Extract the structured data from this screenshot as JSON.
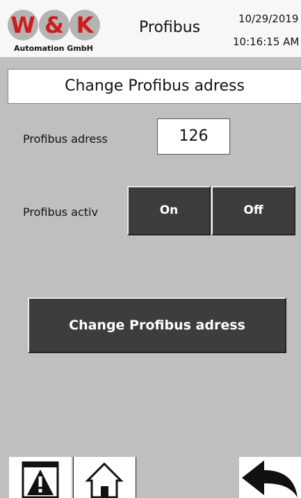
{
  "header": {
    "logo_letters": [
      "W",
      "&",
      "K"
    ],
    "logo_subtitle": "Automation GmbH",
    "title": "Profibus",
    "date": "10/29/2019",
    "time": "10:16:15 AM"
  },
  "banner": {
    "title": "Change Profibus adress"
  },
  "address": {
    "label": "Profibus adress",
    "value": "126"
  },
  "active": {
    "label": "Profibus activ",
    "on_label": "On",
    "off_label": "Off"
  },
  "change_button": {
    "label": "Change Profibus adress"
  },
  "nav": {
    "icons": [
      "warning-icon",
      "home-icon",
      "back-arrow-icon"
    ]
  },
  "colors": {
    "logo_red": "#cf1b1b",
    "logo_circle": "#b4b4b4",
    "button_bg": "#3d3d3d",
    "panel_bg": "#bfbfbf"
  }
}
